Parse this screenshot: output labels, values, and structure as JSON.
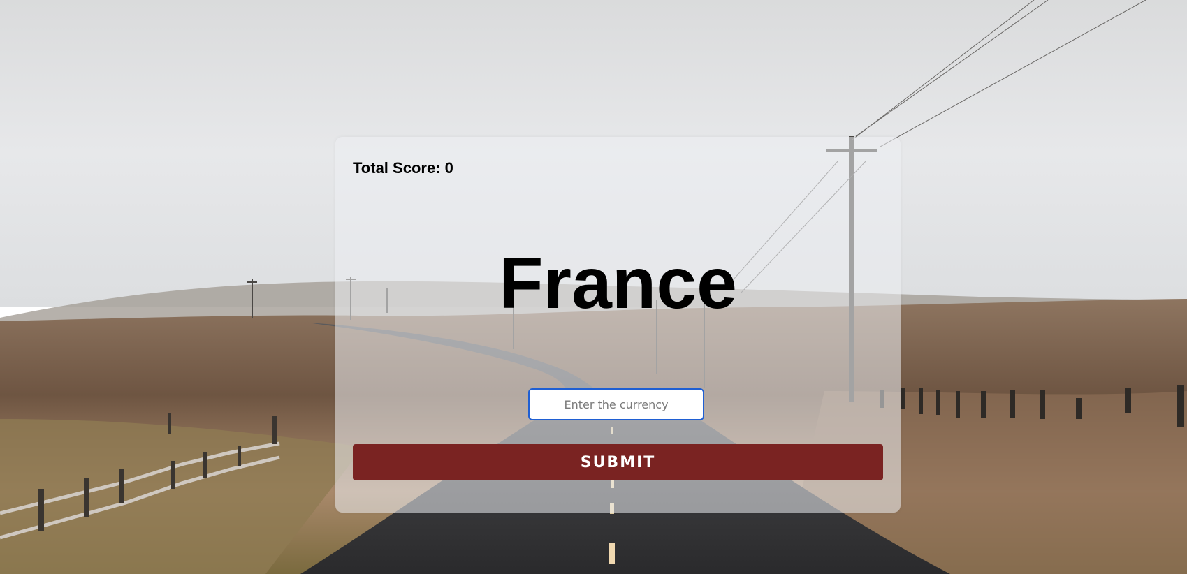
{
  "game": {
    "score_label": "Total Score: 0",
    "country": "France",
    "answer_placeholder": "Enter the currency",
    "answer_value": "",
    "submit_label": "SUBMIT"
  },
  "colors": {
    "submit_background": "#7a2322",
    "input_focus_border": "#1f5fd3",
    "card_background": "rgba(236,239,243,0.55)"
  },
  "background": {
    "description_icon": "countryside-road-photo"
  }
}
